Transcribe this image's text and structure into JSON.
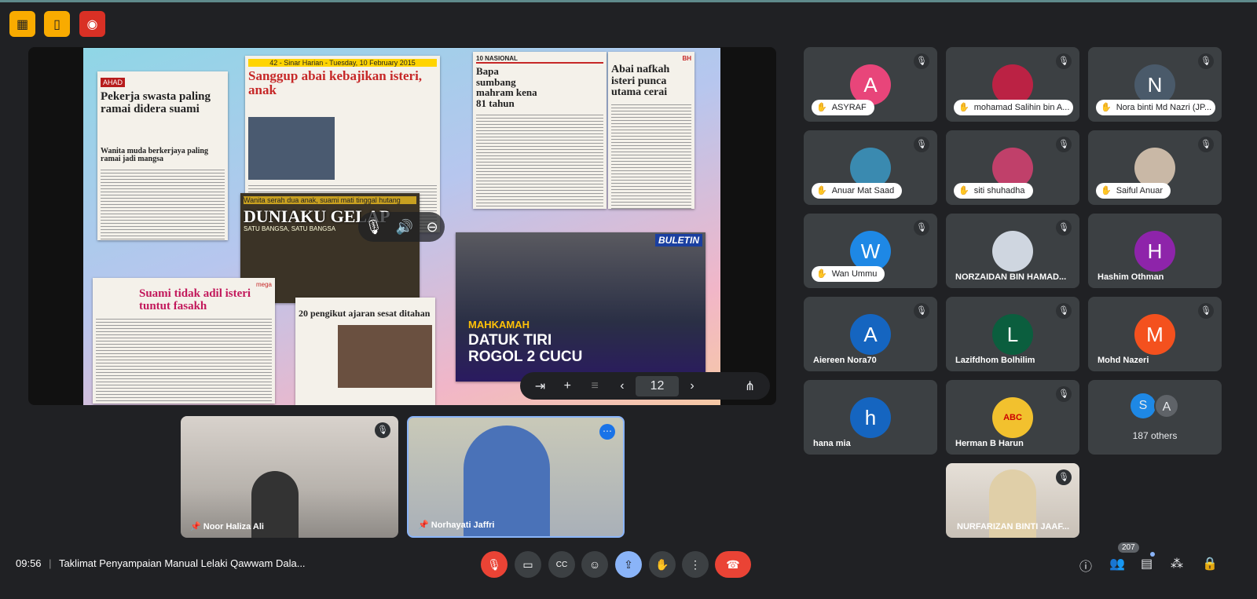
{
  "top_buttons": [
    {
      "icon": "no-present-icon",
      "color": "#f9ab00"
    },
    {
      "icon": "door-icon",
      "color": "#f9ab00"
    },
    {
      "icon": "record-icon",
      "color": "#d93025"
    }
  ],
  "slide": {
    "clips": [
      {
        "masthead": "AHAD",
        "headline": "Pekerja swasta paling ramai didera suami",
        "sub": "Wanita muda berkerjaya paling ramai jadi mangsa"
      },
      {
        "masthead": "42 - Sinar Harian - Tuesday, 10 February 2015",
        "headline": "Sanggup abai kebajikan isteri, anak"
      },
      {
        "masthead": "10 NASIONAL",
        "headline": "Bapa sumbang mahram kena 81 tahun"
      },
      {
        "masthead": "BH",
        "headline": "Abai nafkah isteri punca utama cerai"
      },
      {
        "masthead": "SATU BANGSA, SATU BANGSA",
        "headline": "DUNIAKU GELAP",
        "sub": "Wanita serah dua anak, suami mati tinggal hutang"
      },
      {
        "masthead": "mega",
        "headline": "Suami tidak adil isteri tuntut fasakh"
      },
      {
        "masthead": "",
        "headline": "20 pengikut ajaran sesat ditahan"
      },
      {
        "masthead": "BULETIN",
        "headline": "MAHKAMAH",
        "sub": "DATUK TIRI ROGOL 2 CUCU"
      }
    ]
  },
  "presentation_toolbar": {
    "page": "12"
  },
  "participants": [
    {
      "name": "ASYRAF",
      "initial": "A",
      "color": "#e8457a",
      "hand": true
    },
    {
      "name": "mohamad Salihin bin A...",
      "initial": "",
      "color": "#b24",
      "hand": true
    },
    {
      "name": "Nora binti Md Nazri (JP...",
      "initial": "N",
      "color": "#4a5a6a",
      "hand": true
    },
    {
      "name": "Anuar Mat Saad",
      "initial": "",
      "color": "#3a8ab0",
      "hand": true
    },
    {
      "name": "siti shuhadha",
      "initial": "",
      "color": "#c0406a",
      "hand": true
    },
    {
      "name": "Saiful Anuar",
      "initial": "",
      "color": "#c9b8a6",
      "hand": true
    },
    {
      "name": "Wan Ummu",
      "initial": "W",
      "color": "#1e88e5",
      "hand": true
    },
    {
      "name": "NORZAIDAN BIN HAMAD...",
      "initial": "",
      "color": "#cfd6e0",
      "hand": false
    },
    {
      "name": "Hashim Othman",
      "initial": "H",
      "color": "#8e24aa",
      "hand": false
    },
    {
      "name": "Aiereen Nora70",
      "initial": "A",
      "color": "#1565c0",
      "hand": false
    },
    {
      "name": "Lazifdhom Bolhilim",
      "initial": "L",
      "color": "#0b5e3e",
      "hand": false
    },
    {
      "name": "Mohd Nazeri",
      "initial": "M",
      "color": "#f4511e",
      "hand": false
    },
    {
      "name": "hana mia",
      "initial": "h",
      "color": "#1565c0",
      "hand": false
    },
    {
      "name": "Herman B Harun",
      "initial": "ABC",
      "color": "#f2c12e",
      "hand": false
    }
  ],
  "others": {
    "label": "187 others",
    "initials": [
      "S",
      "A"
    ]
  },
  "video_tiles": [
    {
      "name": "Noor Haliza Ali"
    },
    {
      "name": "Norhayati Jaffri"
    },
    {
      "name": "NURFARIZAN BINTI JAAF..."
    }
  ],
  "meeting": {
    "time": "09:56",
    "title": "Taklimat Penyampaian Manual Lelaki Qawwam Dala..."
  },
  "people_count": "207",
  "colors": {
    "accent": "#8ab4f8",
    "danger": "#ea4335",
    "bg": "#202124",
    "tile": "#3c4043"
  }
}
